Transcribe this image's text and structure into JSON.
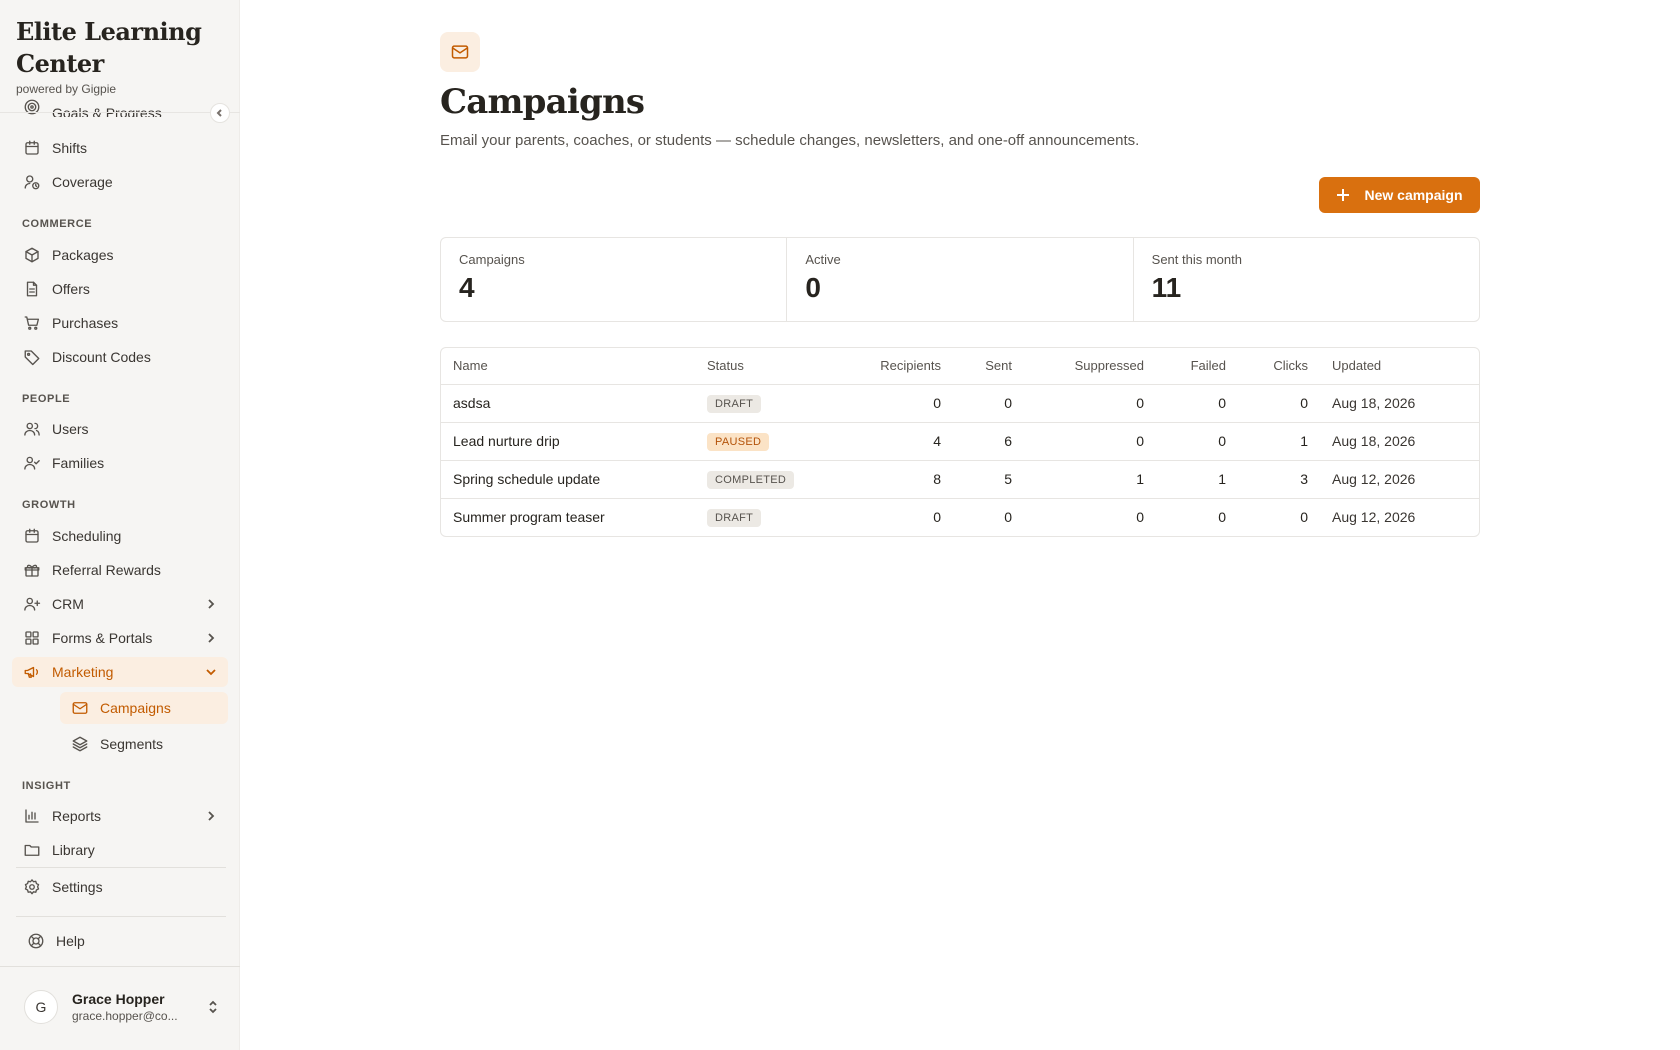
{
  "brand": {
    "title": "Elite Learning Center",
    "subtitle": "powered by Gigpie"
  },
  "nav": {
    "top_items": [
      {
        "label": "Goals & Progress",
        "icon": "target-icon"
      },
      {
        "label": "Shifts",
        "icon": "calendar-icon"
      },
      {
        "label": "Coverage",
        "icon": "user-clock-icon"
      }
    ],
    "sections": {
      "commerce": "COMMERCE",
      "people": "PEOPLE",
      "growth": "GROWTH",
      "insight": "INSIGHT"
    },
    "commerce_items": [
      {
        "label": "Packages",
        "icon": "package-icon"
      },
      {
        "label": "Offers",
        "icon": "document-icon"
      },
      {
        "label": "Purchases",
        "icon": "cart-icon"
      },
      {
        "label": "Discount Codes",
        "icon": "tag-icon"
      }
    ],
    "people_items": [
      {
        "label": "Users",
        "icon": "users-icon"
      },
      {
        "label": "Families",
        "icon": "user-check-icon"
      }
    ],
    "growth_items": [
      {
        "label": "Scheduling",
        "icon": "calendar-icon"
      },
      {
        "label": "Referral Rewards",
        "icon": "gift-icon"
      },
      {
        "label": "CRM",
        "icon": "user-plus-icon"
      },
      {
        "label": "Forms & Portals",
        "icon": "grid-icon"
      },
      {
        "label": "Marketing",
        "icon": "megaphone-icon"
      }
    ],
    "marketing_sub": [
      {
        "label": "Campaigns",
        "icon": "mail-icon"
      },
      {
        "label": "Segments",
        "icon": "layers-icon"
      }
    ],
    "insight_items": [
      {
        "label": "Reports",
        "icon": "bar-chart-icon"
      },
      {
        "label": "Library",
        "icon": "folder-icon"
      }
    ],
    "settings": "Settings",
    "help": "Help"
  },
  "user": {
    "initial": "G",
    "name": "Grace Hopper",
    "email": "grace.hopper@co..."
  },
  "page": {
    "title": "Campaigns",
    "description": "Email your parents, coaches, or students — schedule changes, newsletters, and one-off announcements.",
    "new_button": "New campaign"
  },
  "stats": [
    {
      "label": "Campaigns",
      "value": "4"
    },
    {
      "label": "Active",
      "value": "0"
    },
    {
      "label": "Sent this month",
      "value": "11"
    }
  ],
  "table": {
    "headers": [
      "Name",
      "Status",
      "Recipients",
      "Sent",
      "Suppressed",
      "Failed",
      "Clicks",
      "Updated"
    ],
    "rows": [
      {
        "name": "asdsa",
        "status": "DRAFT",
        "status_type": "draft",
        "recipients": "0",
        "sent": "0",
        "suppressed": "0",
        "failed": "0",
        "clicks": "0",
        "updated": "Aug 18, 2026"
      },
      {
        "name": "Lead nurture drip",
        "status": "PAUSED",
        "status_type": "paused",
        "recipients": "4",
        "sent": "6",
        "suppressed": "0",
        "failed": "0",
        "clicks": "1",
        "updated": "Aug 18, 2026"
      },
      {
        "name": "Spring schedule update",
        "status": "COMPLETED",
        "status_type": "completed",
        "recipients": "8",
        "sent": "5",
        "suppressed": "1",
        "failed": "1",
        "clicks": "3",
        "updated": "Aug 12, 2026"
      },
      {
        "name": "Summer program teaser",
        "status": "DRAFT",
        "status_type": "draft",
        "recipients": "0",
        "sent": "0",
        "suppressed": "0",
        "failed": "0",
        "clicks": "0",
        "updated": "Aug 12, 2026"
      }
    ]
  },
  "colors": {
    "accent": "#d9700f",
    "accent_text": "#c25b00",
    "accent_bg": "#fbeee1",
    "sidebar_bg": "#f6f5f3"
  }
}
